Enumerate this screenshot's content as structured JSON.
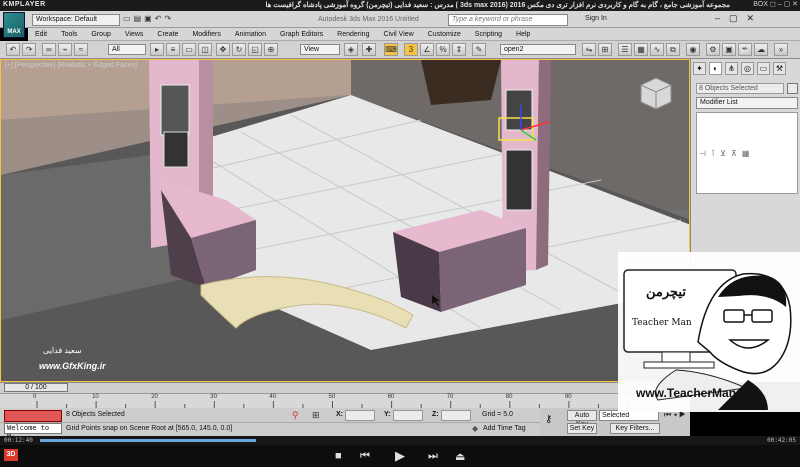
{
  "player": {
    "logo": "KMPLAYER",
    "caption": "مجموعه آموزشی جامع ، گام به گام و کاربردی نرم افزار تری دی مکس 2016 (3ds max 2016 ) مدرس : سعید فدایی (تیچرمن) گروه آموزشی پادشاه گرافیست ها",
    "window_controls": "BOX ◻ – ▢ ✕",
    "time_elapsed": "00:12:40",
    "time_total": "00:42:05",
    "progress": 0.3,
    "badge_3d": "3D",
    "buttons": {
      "stop": "■",
      "prev": "⏮",
      "play": "▶",
      "next": "⏭",
      "eject": "⏏"
    }
  },
  "max": {
    "app_logo": "MAX",
    "workspace": "Workspace: Default",
    "window_title": "Autodesk 3ds Max 2016    Untitled",
    "search_placeholder": "Type a keyword or phrase",
    "signin": "Sign In",
    "menus": [
      "Edit",
      "Tools",
      "Group",
      "Views",
      "Create",
      "Modifiers",
      "Animation",
      "Graph Editors",
      "Rendering",
      "Civil View",
      "Customize",
      "Scripting",
      "Help"
    ],
    "toolbar": {
      "filter": "All",
      "ref_coord": "View",
      "named_sel": "open2"
    },
    "viewport_label": "[+] [Perspective] [Realistic + Edged Faces]",
    "command_panel": {
      "selection": "8 Objects Selected",
      "modifier_list": "Modifier List"
    },
    "time_slider": "0 / 100",
    "ticks": [
      "0",
      "10",
      "20",
      "30",
      "40",
      "50",
      "60",
      "70",
      "80",
      "90",
      "100"
    ],
    "status": {
      "listener": "Welcome to M:",
      "selection": "8 Objects Selected",
      "prompt": "Grid Points snap on Scene Root at [565.0, 145.0, 0.0]",
      "x_label": "X:",
      "y_label": "Y:",
      "z_label": "Z:",
      "grid": "Grid = 5.0",
      "add_time_tag": "Add Time Tag",
      "auto_key": "Auto Key",
      "set_key": "Set Key",
      "selected": "Selected",
      "key_filters": "Key Filters..."
    }
  },
  "watermark": {
    "logo_text_fa": "تیچرمن",
    "brand": "Teacher Man",
    "url": "www.TeacherMan.ir",
    "gfx_author": "سعید فدایی",
    "gfx_site": "www.GfxKing.ir"
  }
}
